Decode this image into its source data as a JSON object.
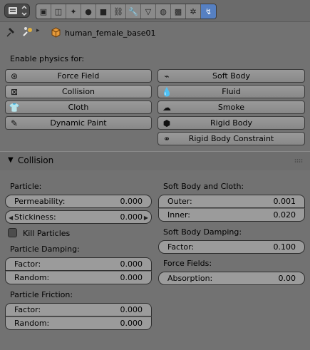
{
  "header": {
    "editor_icon": "properties-editor-icon",
    "tabs": [
      {
        "name": "render-icon",
        "glyph": "▣",
        "active": false
      },
      {
        "name": "render-layers-icon",
        "glyph": "◫",
        "active": false
      },
      {
        "name": "scene-icon",
        "glyph": "✦",
        "active": false
      },
      {
        "name": "world-icon",
        "glyph": "●",
        "active": false
      },
      {
        "name": "object-icon",
        "glyph": "■",
        "active": false
      },
      {
        "name": "constraints-icon",
        "glyph": "⛓",
        "active": false
      },
      {
        "name": "modifiers-icon",
        "glyph": "🔧",
        "active": false
      },
      {
        "name": "data-icon",
        "glyph": "▽",
        "active": false
      },
      {
        "name": "material-icon",
        "glyph": "◍",
        "active": false
      },
      {
        "name": "texture-icon",
        "glyph": "▩",
        "active": false
      },
      {
        "name": "particles-icon",
        "glyph": "✲",
        "active": false
      },
      {
        "name": "physics-icon",
        "glyph": "↯",
        "active": true
      }
    ],
    "accent": "#5680c2"
  },
  "breadcrumb": {
    "object_name": "human_female_base01"
  },
  "physics": {
    "enable_label": "Enable physics for:",
    "buttons": [
      {
        "name": "force-field-button",
        "label": "Force Field",
        "icon": "force-field-icon",
        "glyph": "⊛",
        "checked": false
      },
      {
        "name": "soft-body-button",
        "label": "Soft Body",
        "icon": "soft-body-icon",
        "glyph": "⌁",
        "checked": false
      },
      {
        "name": "collision-button",
        "label": "Collision",
        "icon": "close-icon",
        "glyph": "⊠",
        "checked": true
      },
      {
        "name": "fluid-button",
        "label": "Fluid",
        "icon": "fluid-icon",
        "glyph": "💧",
        "checked": false
      },
      {
        "name": "cloth-button",
        "label": "Cloth",
        "icon": "cloth-icon",
        "glyph": "👕",
        "checked": false
      },
      {
        "name": "smoke-button",
        "label": "Smoke",
        "icon": "smoke-icon",
        "glyph": "☁",
        "checked": false
      },
      {
        "name": "dynamic-paint-button",
        "label": "Dynamic Paint",
        "icon": "brush-icon",
        "glyph": "✎",
        "checked": false
      },
      {
        "name": "rigid-body-button",
        "label": "Rigid Body",
        "icon": "rigid-body-icon",
        "glyph": "⬢",
        "checked": false
      },
      {
        "name": "rigid-body-constraint-button",
        "label": "Rigid Body Constraint",
        "icon": "link-icon",
        "glyph": "⚭",
        "checked": false
      }
    ]
  },
  "collision": {
    "title": "Collision",
    "particle": {
      "heading": "Particle:",
      "permeability": {
        "label": "Permeability:",
        "value": "0.000"
      },
      "stickiness": {
        "label": "Stickiness:",
        "value": "0.000"
      },
      "kill_particles": {
        "label": "Kill Particles",
        "checked": false
      }
    },
    "particle_damping": {
      "heading": "Particle Damping:",
      "factor": {
        "label": "Factor:",
        "value": "0.000"
      },
      "random": {
        "label": "Random:",
        "value": "0.000"
      }
    },
    "particle_friction": {
      "heading": "Particle Friction:",
      "factor": {
        "label": "Factor:",
        "value": "0.000"
      },
      "random": {
        "label": "Random:",
        "value": "0.000"
      }
    },
    "soft_body_cloth": {
      "heading": "Soft Body and Cloth:",
      "outer": {
        "label": "Outer:",
        "value": "0.001"
      },
      "inner": {
        "label": "Inner:",
        "value": "0.020"
      }
    },
    "soft_body_damping": {
      "heading": "Soft Body Damping:",
      "factor": {
        "label": "Factor:",
        "value": "0.100"
      }
    },
    "force_fields": {
      "heading": "Force Fields:",
      "absorption": {
        "label": "Absorption:",
        "value": "0.00"
      }
    }
  }
}
